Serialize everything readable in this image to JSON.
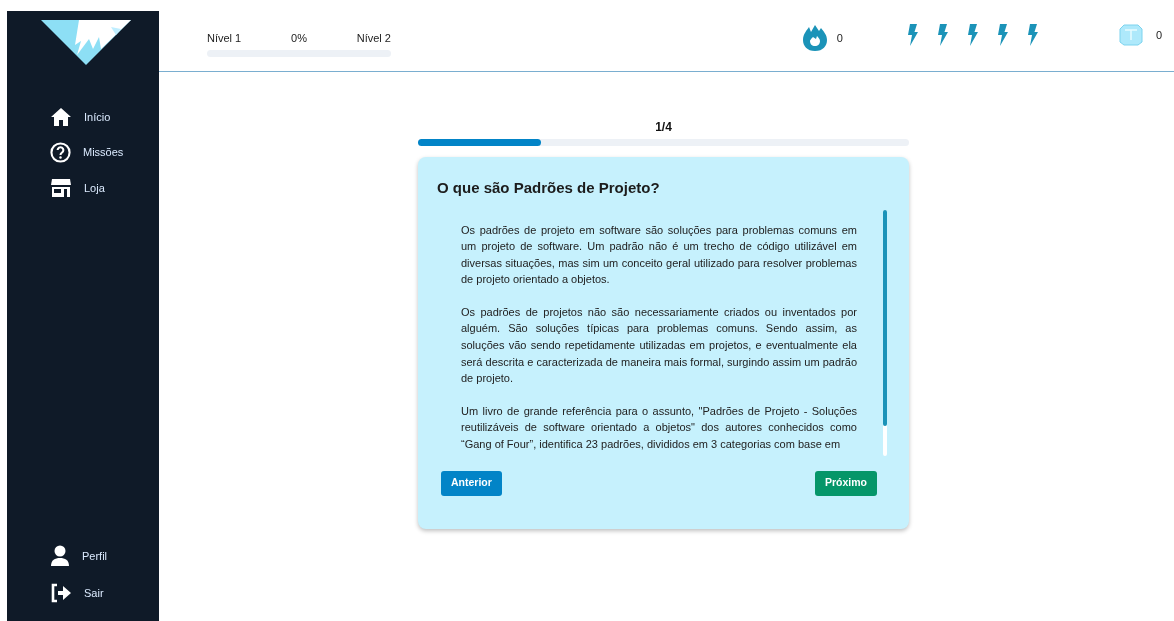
{
  "sidebar": {
    "items": [
      {
        "label": "Início",
        "kind": "home"
      },
      {
        "label": "Missões",
        "kind": "missions"
      },
      {
        "label": "Loja",
        "kind": "store"
      }
    ],
    "bottom_items": [
      {
        "label": "Perfil",
        "kind": "profile"
      },
      {
        "label": "Sair",
        "kind": "logout"
      }
    ]
  },
  "header": {
    "level_from": "Nível 1",
    "percent": "0%",
    "level_to": "Nível 2",
    "level": 0,
    "streak": "0",
    "gems": "0"
  },
  "lesson": {
    "step": "1/4",
    "level": 0.25,
    "title": "O que são Padrões de Projeto?",
    "paragraphs": [
      "Os padrões de projeto em software são soluções para problemas comuns em um projeto de software. Um padrão não é um trecho de código utilizável em diversas situações, mas sim um conceito geral utilizado para resolver problemas de projeto orientado a objetos.",
      "Os padrões de projetos não são necessariamente criados ou inventados por alguém. São soluções típicas para problemas comuns. Sendo assim, as soluções vão sendo repetidamente utilizadas em projetos, e eventualmente ela será descrita e caracterizada de maneira mais formal, surgindo assim um padrão de projeto.",
      "Um livro de grande referência para o assunto, \"Padrões de Projeto - Soluções reutilizáveis de software orientado a objetos\" dos autores conhecidos como “Gang of Four”, identifica 23 padrões, divididos em 3 categorias com base em"
    ],
    "prev_button": "Anterior",
    "next_button": "Próximo"
  }
}
